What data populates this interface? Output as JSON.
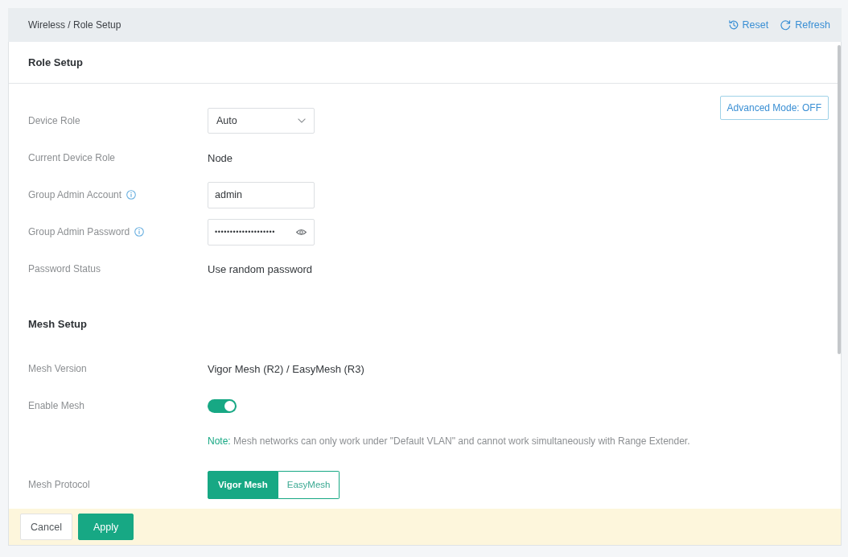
{
  "breadcrumb": "Wireless / Role Setup",
  "header_actions": [
    {
      "kind": "reset",
      "label": "Reset"
    },
    {
      "kind": "refresh",
      "label": "Refresh"
    }
  ],
  "panel": {
    "title": "Role Setup",
    "advanced_mode_button": "Advanced Mode: OFF"
  },
  "role_fields": [
    {
      "kind": "select",
      "label": "Device Role",
      "info": false,
      "value": "Auto"
    },
    {
      "kind": "text",
      "label": "Current Device Role",
      "info": false,
      "value": "Node"
    },
    {
      "kind": "input",
      "label": "Group Admin Account",
      "info": true,
      "value": "admin"
    },
    {
      "kind": "password",
      "label": "Group Admin Password",
      "info": true,
      "value": "••••••••••••••••••••"
    },
    {
      "kind": "text",
      "label": "Password Status",
      "info": false,
      "value": "Use random password"
    }
  ],
  "mesh_section": {
    "title": "Mesh Setup",
    "fields": [
      {
        "kind": "text",
        "label": "Mesh Version",
        "value": "Vigor Mesh (R2) / EasyMesh (R3)"
      },
      {
        "kind": "toggle",
        "label": "Enable Mesh",
        "on": true
      },
      {
        "kind": "note",
        "note_label": "Note:",
        "text": "Mesh networks can only work under \"Default VLAN\" and cannot work simultaneously with Range Extender."
      },
      {
        "kind": "segmented",
        "label": "Mesh Protocol",
        "options": [
          {
            "label": "Vigor Mesh",
            "selected": true
          },
          {
            "label": "EasyMesh",
            "selected": false
          }
        ]
      }
    ]
  },
  "footer_buttons": [
    {
      "kind": "secondary",
      "label": "Cancel"
    },
    {
      "kind": "primary",
      "label": "Apply"
    }
  ]
}
